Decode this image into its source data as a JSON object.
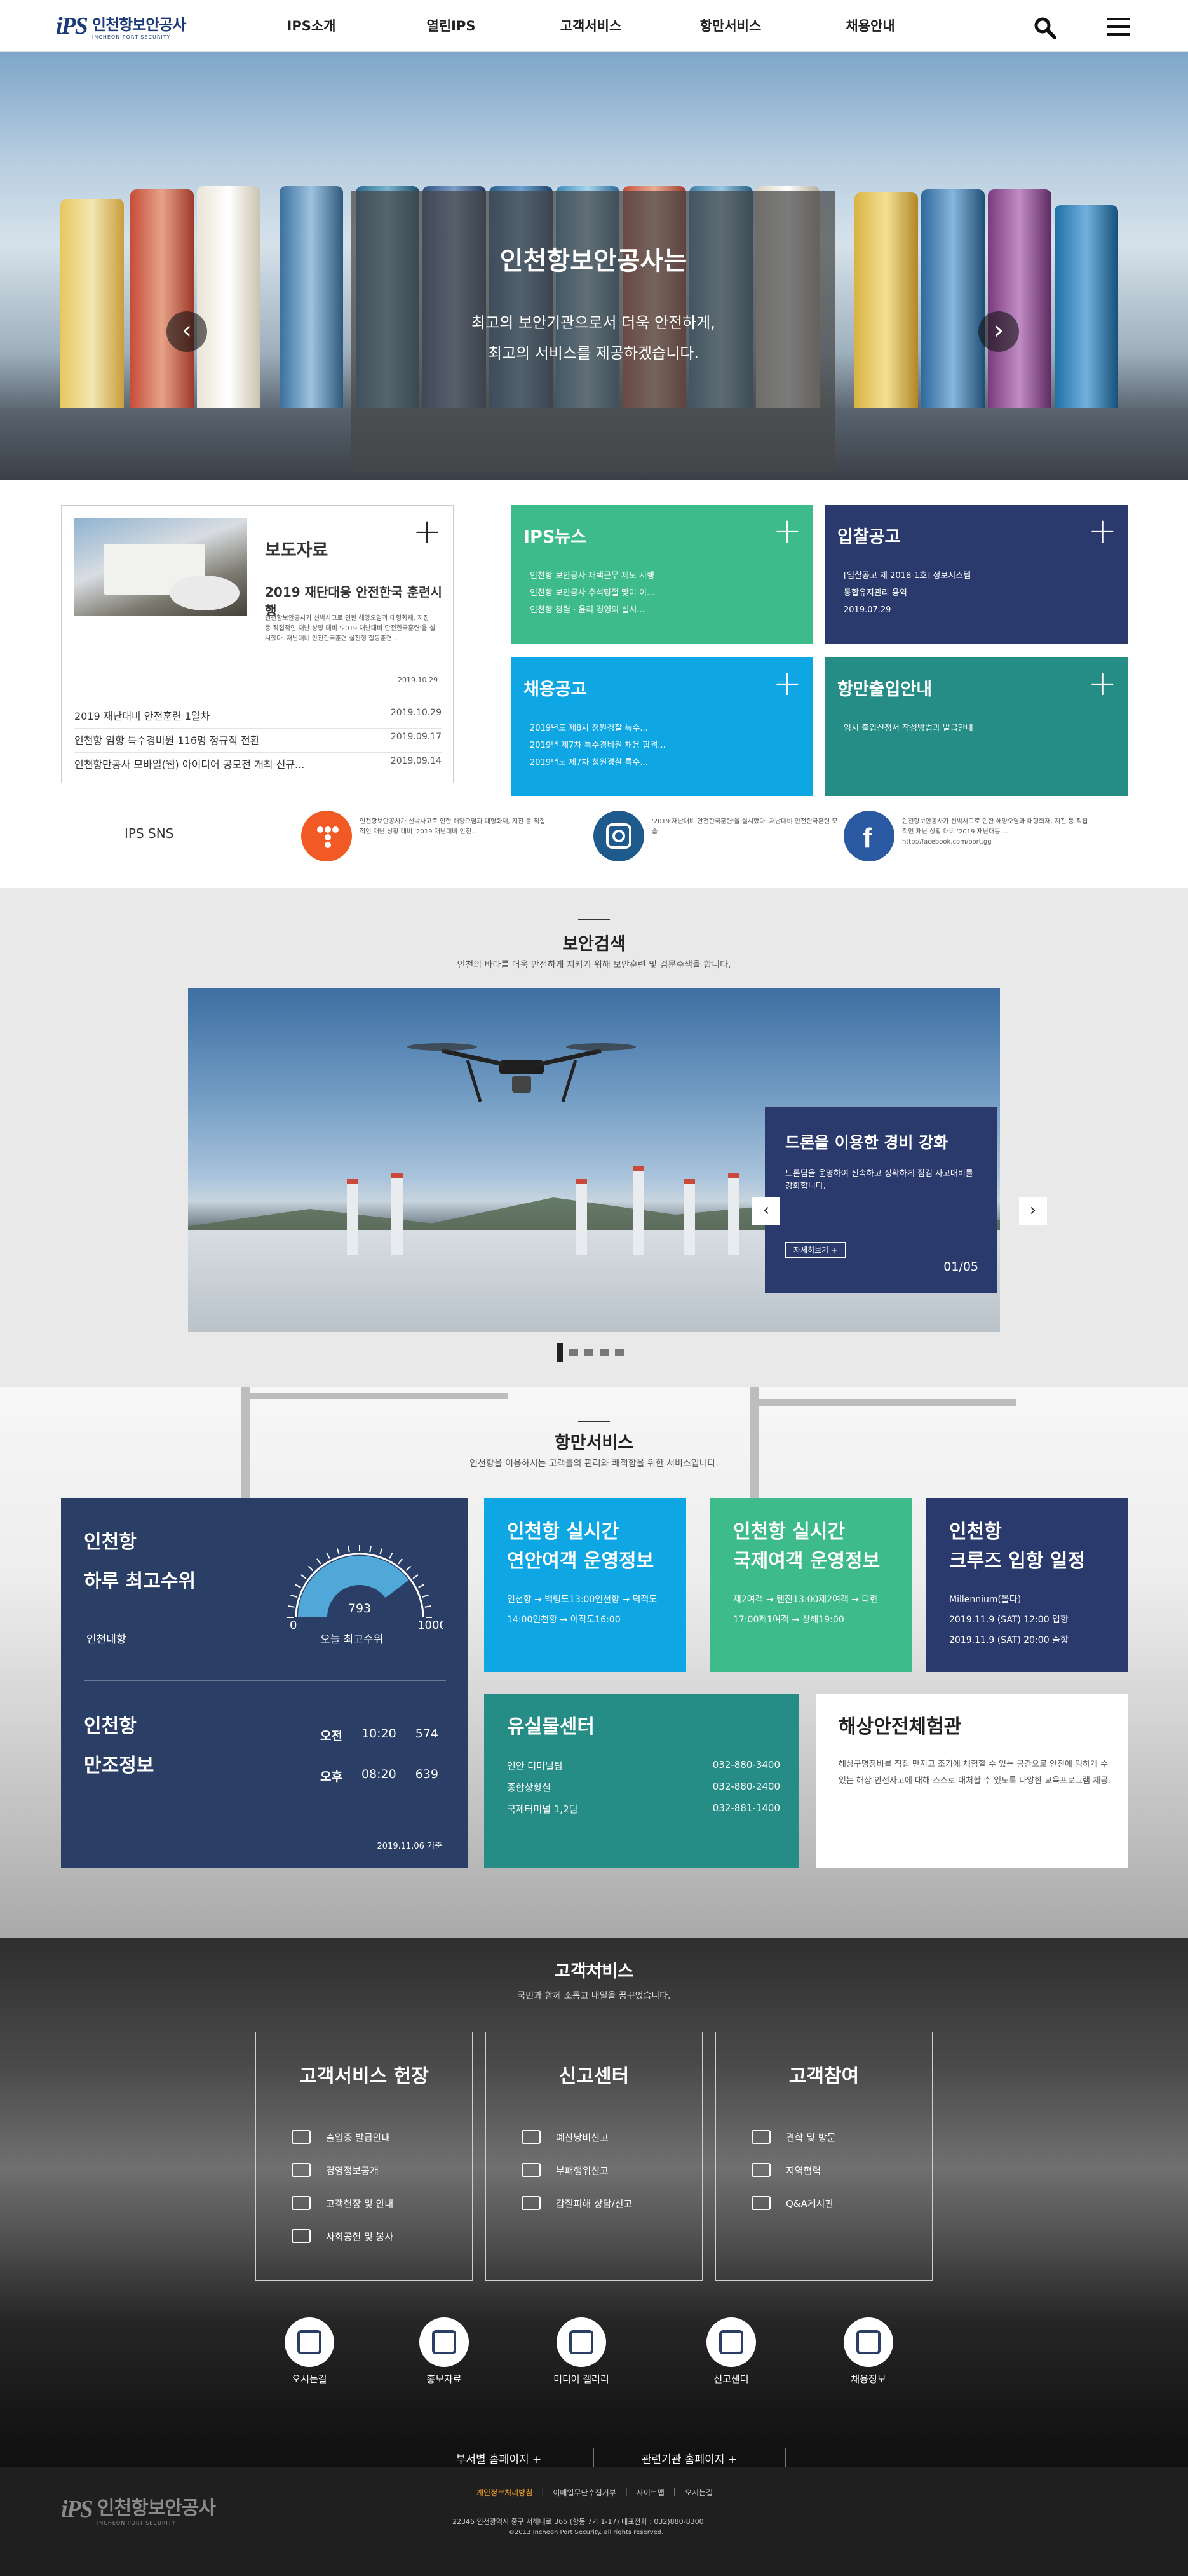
{
  "header": {
    "logo_mark": "iPS",
    "logo_ko": "인천항보안공사",
    "logo_en": "INCHEON PORT SECURITY",
    "nav": [
      "IPS소개",
      "열린IPS",
      "고객서비스",
      "항만서비스",
      "채용안내"
    ]
  },
  "hero": {
    "title": "인천항보안공사는",
    "sub1": "최고의 보안기관으로서 더욱 안전하게,",
    "sub2": "최고의 서비스를 제공하겠습니다.",
    "prev": "‹",
    "next": "›",
    "active_slide": 2
  },
  "press": {
    "title": "보도자료",
    "plus": "+",
    "headline": "2019 재단대응 안전한국 훈련시행",
    "body": "인천항보안공사가 선박사고로 인한 해양오염과 대형화재, 지진 등 직접적인 재난 상황 대비 '2019 재난대비 안전한국훈련'을 실시했다. 재난대비 안전한국훈련 실전형 합동훈련...",
    "date": "2019.10.29",
    "items": [
      {
        "text": "2019 재난대비 안전훈련 1일차",
        "date": "2019.10.29"
      },
      {
        "text": "인천항 임항 특수경비원 116명 정규직 전환",
        "date": "2019.09.17"
      },
      {
        "text": "인천항만공사 모바일(웹) 아이디어 공모전 개최 신규...",
        "date": "2019.09.14"
      }
    ]
  },
  "cards": {
    "news": {
      "title": "IPS뉴스",
      "lines": [
        "인천항 보안공사 재택근무 제도 시행",
        "인천항 보안공사 추석명절 맞이 이...",
        "인천항 청렴 · 윤리 경영의 실시..."
      ]
    },
    "notice": {
      "title": "입찰공고",
      "lines": [
        "[입찰공고 제 2018-1호] 정보시스템",
        "통합유지관리 용역",
        "2019.07.29"
      ]
    },
    "recruit": {
      "title": "채용공고",
      "lines": [
        "2019년도 제8차 청원경찰 특수...",
        "2019년 제7차 특수경비원 채용 합격...",
        "2019년도 제7차 청원경찰 특수..."
      ]
    },
    "port_entry": {
      "title": "항만출입안내",
      "lines": [
        "임시 출입신청서 작성방법과 발급안내"
      ]
    }
  },
  "sns": {
    "label": "IPS SNS",
    "items": [
      {
        "icon": "twitter-icon",
        "color": "#f15a24",
        "text": "인천항보안공사가 선박사고로 인한 해양오염과 대형화재, 지진 등 직접적인 재난 상황 대비 '2019 재난대비 안전..."
      },
      {
        "icon": "instagram-icon",
        "color": "#1f5a8c",
        "text": "'2019 재난대비 안전한국훈련'을 실시했다. 재난대비 안전한국훈련 모습"
      },
      {
        "icon": "facebook-icon",
        "color": "#2b5aa3",
        "text": "인천항보안공사가 선박사고로 인한 해양오염과 대형화재, 지진 등 직접적인 재난 상황 대비 '2019 재난대응 ... http://facebook.com/port.gg"
      }
    ]
  },
  "security": {
    "title": "보안검색",
    "sub": "인천의 바다를 더욱 안전하게 지키기 위해 보안훈련 및 검문수색을 합니다.",
    "panel_title": "드론을 이용한 경비 강화",
    "panel_text": "드론팀을 운영하여 신속하고 정확하게 점검 사고대비를 강화합니다.",
    "more": "자세히보기 +",
    "page": "01/05",
    "prev": "‹",
    "next": "›",
    "active_slide": 1
  },
  "port": {
    "title": "항만서비스",
    "sub": "인천항을 이용하시는 고객들의 편리와 쾌적함을 위한 서비스입니다.",
    "tide": {
      "title1": "인천항",
      "title2": "하루 최고수위",
      "label": "인천내항",
      "value": "793",
      "min": "0",
      "max": "1000",
      "level": 0.793,
      "caption": "오늘 최고수위",
      "tide_title1": "인천항",
      "tide_title2": "만조정보",
      "rows": [
        {
          "label": "오전",
          "time": "10:20",
          "value": "574"
        },
        {
          "label": "오후",
          "time": "08:20",
          "value": "639"
        }
      ],
      "date": "2019.11.06 기준"
    },
    "c1": {
      "title1": "인천항 실시간",
      "title2": "연안여객 운영정보",
      "lines": [
        "인천항 → 백령도13:00인천항 → 덕적도",
        "14:00인천항 → 이작도16:00"
      ]
    },
    "c2": {
      "title1": "인천항 실시간",
      "title2": "국제여객 운영정보",
      "lines": [
        "제2여객 → 텐진13:00제2여객 → 다롄",
        "17:00제1여객 → 상해19:00"
      ]
    },
    "c3": {
      "title1": "인천항",
      "title2": "크루즈 입항 일정",
      "lines": [
        "Millennium(몰타)",
        "2019.11.9 (SAT) 12:00 입항",
        "2019.11.9 (SAT) 20:00 출항"
      ]
    },
    "lost": {
      "title": "유실물센터",
      "rows": [
        {
          "name": "연안 터미널팀",
          "tel": "032-880-3400"
        },
        {
          "name": "종합상황실",
          "tel": "032-880-2400"
        },
        {
          "name": "국제터미널 1,2팀",
          "tel": "032-881-1400"
        }
      ]
    },
    "safety": {
      "title": "해상안전체험관",
      "text": "해상구명장비를 직접 만지고 조기에 체험할 수 있는 공간으로 안전에 임하게 수 있는 해상 안전사고에 대해 스스로 대처할 수 있도록 다양한 교육프로그램 제공."
    }
  },
  "cs": {
    "title": "고객서비스",
    "sub": "국민과 함께 소통고 내일을 꿈꾸었습니다.",
    "boxes": [
      {
        "title": "고객서비스 헌장",
        "items": [
          "출입증 발급안내",
          "경영정보공개",
          "고객헌장 및 안내",
          "사회공헌 및 봉사"
        ]
      },
      {
        "title": "신고센터",
        "items": [
          "예산낭비신고",
          "부패행위신고",
          "갑질피해 상담/신고"
        ]
      },
      {
        "title": "고객참여",
        "items": [
          "견학 및 방문",
          "지역협력",
          "Q&A게시판"
        ]
      }
    ],
    "quick": [
      "오시는길",
      "홍보자료",
      "미디어 갤러리",
      "신고센터",
      "채용정보"
    ]
  },
  "footer": {
    "link1": "부서별 홈페이지 +",
    "link2": "관련기관 홈페이지 +",
    "menu": [
      "개인정보처리방침",
      "이메일무단수집거부",
      "사이트맵",
      "오시는길"
    ],
    "address": "22346 인천광역시 중구 서해대로 365 (항동 7가 1-17)   대표전화 : 032)880-8300",
    "copyright": "©2013 Incheon Port Security. all rights reserved."
  }
}
